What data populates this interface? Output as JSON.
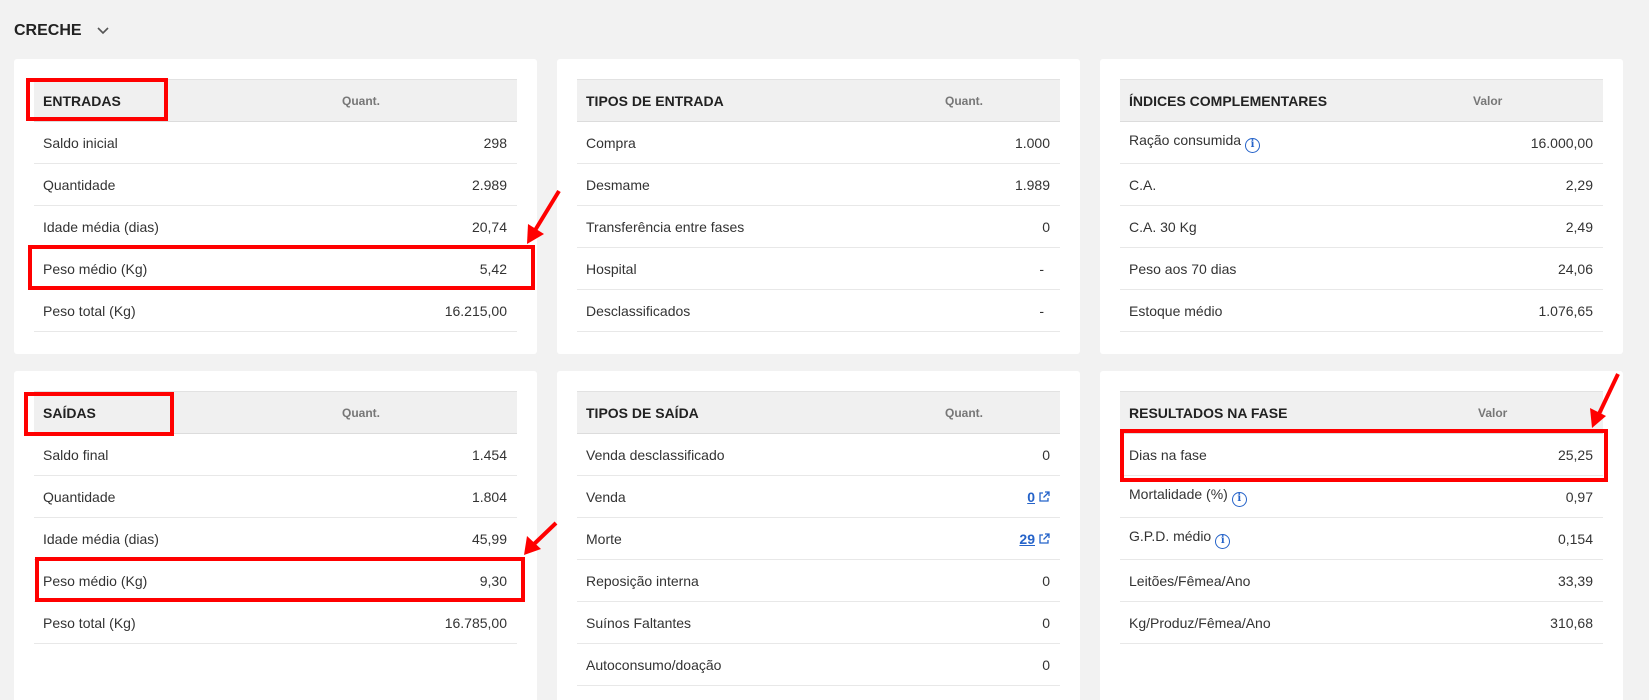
{
  "section": {
    "title": "CRECHE"
  },
  "entradas": {
    "title": "ENTRADAS",
    "col": "Quant.",
    "rows": [
      {
        "label": "Saldo inicial",
        "value": "298"
      },
      {
        "label": "Quantidade",
        "value": "2.989"
      },
      {
        "label": "Idade média (dias)",
        "value": "20,74"
      },
      {
        "label": "Peso médio (Kg)",
        "value": "5,42"
      },
      {
        "label": "Peso total (Kg)",
        "value": "16.215,00"
      }
    ]
  },
  "tipos_entrada": {
    "title": "TIPOS DE ENTRADA",
    "col": "Quant.",
    "rows": [
      {
        "label": "Compra",
        "value": "1.000"
      },
      {
        "label": "Desmame",
        "value": "1.989"
      },
      {
        "label": "Transferência entre fases",
        "value": "0"
      },
      {
        "label": "Hospital",
        "value": "-"
      },
      {
        "label": "Desclassificados",
        "value": "-"
      }
    ]
  },
  "indices": {
    "title": "ÍNDICES COMPLEMENTARES",
    "col": "Valor",
    "rows": [
      {
        "label": "Ração consumida",
        "value": "16.000,00"
      },
      {
        "label": "C.A.",
        "value": "2,29"
      },
      {
        "label": "C.A. 30 Kg",
        "value": "2,49"
      },
      {
        "label": "Peso aos 70 dias",
        "value": "24,06"
      },
      {
        "label": "Estoque médio",
        "value": "1.076,65"
      }
    ]
  },
  "saidas": {
    "title": "SAÍDAS",
    "col": "Quant.",
    "rows": [
      {
        "label": "Saldo final",
        "value": "1.454"
      },
      {
        "label": "Quantidade",
        "value": "1.804"
      },
      {
        "label": "Idade média (dias)",
        "value": "45,99"
      },
      {
        "label": "Peso médio (Kg)",
        "value": "9,30"
      },
      {
        "label": "Peso total (Kg)",
        "value": "16.785,00"
      }
    ]
  },
  "tipos_saida": {
    "title": "TIPOS DE SAÍDA",
    "col": "Quant.",
    "rows": [
      {
        "label": "Venda desclassificado",
        "value": "0"
      },
      {
        "label": "Venda",
        "value": "0"
      },
      {
        "label": "Morte",
        "value": "29"
      },
      {
        "label": "Reposição interna",
        "value": "0"
      },
      {
        "label": "Suínos Faltantes",
        "value": "0"
      },
      {
        "label": "Autoconsumo/doação",
        "value": "0"
      }
    ]
  },
  "resultados": {
    "title": "RESULTADOS NA FASE",
    "col": "Valor",
    "rows": [
      {
        "label": "Dias na fase",
        "value": "25,25"
      },
      {
        "label": "Mortalidade (%)",
        "value": "0,97"
      },
      {
        "label": "G.P.D. médio",
        "value": "0,154"
      },
      {
        "label": "Leitões/Fêmea/Ano",
        "value": "33,39"
      },
      {
        "label": "Kg/Produz/Fêmea/Ano",
        "value": "310,68"
      }
    ]
  },
  "colors": {
    "highlight": "#ff0000",
    "link": "#2563c9",
    "background": "#f2f2f2"
  },
  "icons": {
    "info": "info-icon",
    "external": "external-link-icon",
    "chevron": "chevron-down-icon"
  }
}
